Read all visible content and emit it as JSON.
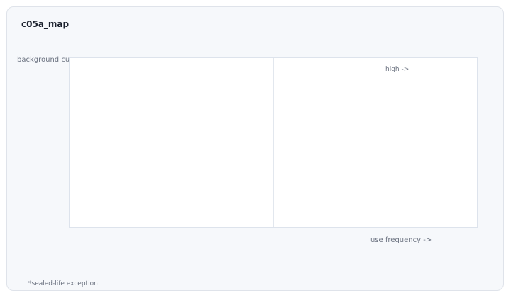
{
  "card": {
    "title": "c05a_map",
    "footnote": "*sealed-life exception"
  },
  "map": {
    "y_axis_label": "background current ->",
    "x_axis_label": "use frequency ->",
    "quadrant_label_high": "high ->"
  }
}
